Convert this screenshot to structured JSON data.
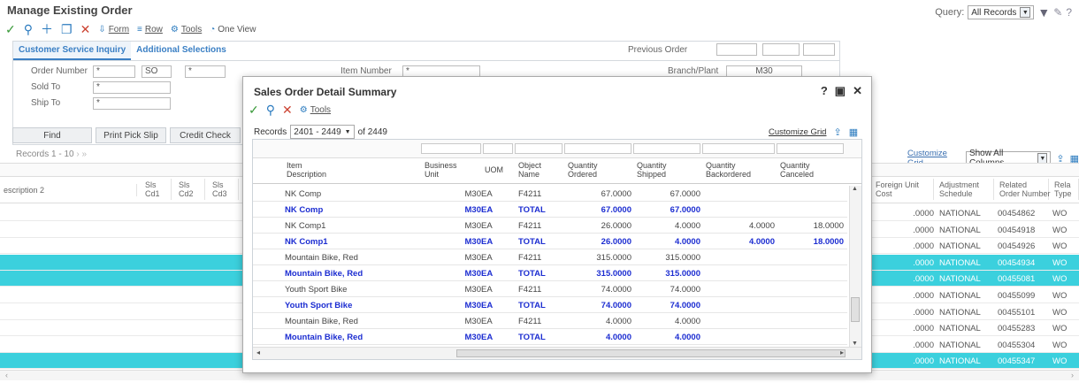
{
  "page": {
    "title": "Manage Existing Order"
  },
  "query": {
    "label": "Query:",
    "value": "All Records"
  },
  "toolbar": {
    "form": "Form",
    "row": "Row",
    "tools": "Tools",
    "oneview": "One View"
  },
  "tabs": {
    "tab1": "Customer Service Inquiry",
    "tab2": "Additional Selections"
  },
  "fields": {
    "order_number_label": "Order Number",
    "order_number_value": "*",
    "order_type_value": "SO",
    "order_company_value": "*",
    "sold_to_label": "Sold To",
    "sold_to_value": "*",
    "ship_to_label": "Ship To",
    "ship_to_value": "*",
    "item_number_label": "Item Number",
    "item_number_value": "*",
    "branch_label": "Branch/Plant",
    "branch_value": "M30",
    "previous_order_label": "Previous Order"
  },
  "buttons": {
    "find": "Find",
    "print_pick_slip": "Print Pick Slip",
    "credit_check": "Credit Check"
  },
  "records": {
    "label": "Records 1 - 10"
  },
  "main_grid": {
    "customize": "Customize Grid",
    "show_columns": "Show All Columns",
    "left_headers": [
      "escription 2",
      "Sls\nCd1",
      "Sls\nCd2",
      "Sls\nCd3"
    ],
    "right_headers": [
      "Foreign Unit\nCost",
      "Adjustment\nSchedule",
      "Related\nOrder Number",
      "Rela\nType"
    ],
    "rows": [
      {
        "cost": ".0000",
        "sched": "NATIONAL",
        "order": "00454862",
        "type": "WO",
        "hl": false
      },
      {
        "cost": ".0000",
        "sched": "NATIONAL",
        "order": "00454918",
        "type": "WO",
        "hl": false
      },
      {
        "cost": ".0000",
        "sched": "NATIONAL",
        "order": "00454926",
        "type": "WO",
        "hl": false
      },
      {
        "cost": ".0000",
        "sched": "NATIONAL",
        "order": "00454934",
        "type": "WO",
        "hl": true
      },
      {
        "cost": ".0000",
        "sched": "NATIONAL",
        "order": "00455081",
        "type": "WO",
        "hl": true
      },
      {
        "cost": ".0000",
        "sched": "NATIONAL",
        "order": "00455099",
        "type": "WO",
        "hl": false
      },
      {
        "cost": ".0000",
        "sched": "NATIONAL",
        "order": "00455101",
        "type": "WO",
        "hl": false
      },
      {
        "cost": ".0000",
        "sched": "NATIONAL",
        "order": "00455283",
        "type": "WO",
        "hl": false
      },
      {
        "cost": ".0000",
        "sched": "NATIONAL",
        "order": "00455304",
        "type": "WO",
        "hl": false
      },
      {
        "cost": ".0000",
        "sched": "NATIONAL",
        "order": "00455347",
        "type": "WO",
        "hl": true
      }
    ]
  },
  "popup": {
    "title": "Sales Order Detail Summary",
    "tools": "Tools",
    "records_label": "Records",
    "records_range": "2401 - 2449",
    "records_total": "of 2449",
    "customize": "Customize Grid",
    "headers": {
      "item": "Item\nDescription",
      "bu": "Business\nUnit",
      "uom": "UOM",
      "obj": "Object\nName",
      "q_ord": "Quantity\nOrdered",
      "q_ship": "Quantity\nShipped",
      "q_back": "Quantity\nBackordered",
      "q_canc": "Quantity\nCanceled"
    },
    "rows": [
      {
        "item": "NK Comp",
        "bu": "M30",
        "uom": "EA",
        "obj": "F4211",
        "q_ord": "67.0000",
        "q_ship": "67.0000",
        "q_back": "",
        "q_canc": "",
        "total": false
      },
      {
        "item": "NK Comp",
        "bu": "M30",
        "uom": "EA",
        "obj": "TOTAL",
        "q_ord": "67.0000",
        "q_ship": "67.0000",
        "q_back": "",
        "q_canc": "",
        "total": true
      },
      {
        "item": "NK Comp1",
        "bu": "M30",
        "uom": "EA",
        "obj": "F4211",
        "q_ord": "26.0000",
        "q_ship": "4.0000",
        "q_back": "4.0000",
        "q_canc": "18.0000",
        "total": false
      },
      {
        "item": "NK Comp1",
        "bu": "M30",
        "uom": "EA",
        "obj": "TOTAL",
        "q_ord": "26.0000",
        "q_ship": "4.0000",
        "q_back": "4.0000",
        "q_canc": "18.0000",
        "total": true
      },
      {
        "item": "Mountain Bike, Red",
        "bu": "M30",
        "uom": "EA",
        "obj": "F4211",
        "q_ord": "315.0000",
        "q_ship": "315.0000",
        "q_back": "",
        "q_canc": "",
        "total": false
      },
      {
        "item": "Mountain Bike, Red",
        "bu": "M30",
        "uom": "EA",
        "obj": "TOTAL",
        "q_ord": "315.0000",
        "q_ship": "315.0000",
        "q_back": "",
        "q_canc": "",
        "total": true
      },
      {
        "item": "Youth Sport Bike",
        "bu": "M30",
        "uom": "EA",
        "obj": "F4211",
        "q_ord": "74.0000",
        "q_ship": "74.0000",
        "q_back": "",
        "q_canc": "",
        "total": false
      },
      {
        "item": "Youth Sport Bike",
        "bu": "M30",
        "uom": "EA",
        "obj": "TOTAL",
        "q_ord": "74.0000",
        "q_ship": "74.0000",
        "q_back": "",
        "q_canc": "",
        "total": true
      },
      {
        "item": "Mountain Bike, Red",
        "bu": "M30",
        "uom": "EA",
        "obj": "F4211",
        "q_ord": "4.0000",
        "q_ship": "4.0000",
        "q_back": "",
        "q_canc": "",
        "total": false
      },
      {
        "item": "Mountain Bike, Red",
        "bu": "M30",
        "uom": "EA",
        "obj": "TOTAL",
        "q_ord": "4.0000",
        "q_ship": "4.0000",
        "q_back": "",
        "q_canc": "",
        "total": true
      }
    ]
  }
}
